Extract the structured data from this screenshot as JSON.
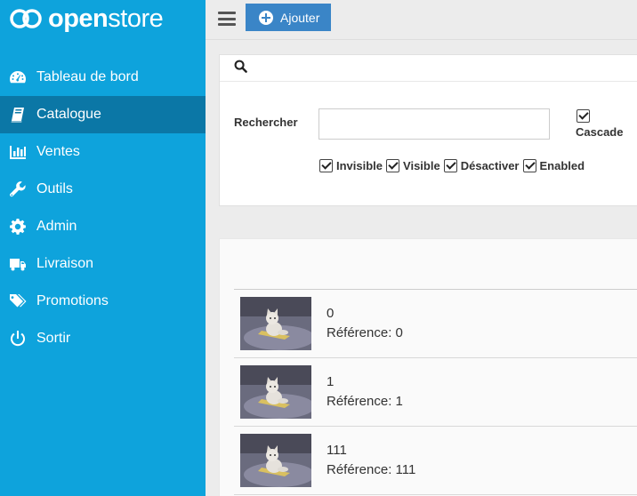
{
  "brand": {
    "name_bold": "open",
    "name_light": "store"
  },
  "sidebar": {
    "items": [
      {
        "label": "Tableau de bord",
        "icon": "dashboard-icon",
        "active": false
      },
      {
        "label": "Catalogue",
        "icon": "book-icon",
        "active": true
      },
      {
        "label": "Ventes",
        "icon": "bar-chart-icon",
        "active": false
      },
      {
        "label": "Outils",
        "icon": "wrench-icon",
        "active": false
      },
      {
        "label": "Admin",
        "icon": "gear-icon",
        "active": false
      },
      {
        "label": "Livraison",
        "icon": "truck-icon",
        "active": false
      },
      {
        "label": "Promotions",
        "icon": "tags-icon",
        "active": false
      },
      {
        "label": "Sortir",
        "icon": "power-icon",
        "active": false
      }
    ]
  },
  "toolbar": {
    "add_label": "Ajouter"
  },
  "search": {
    "label": "Rechercher",
    "value": "",
    "placeholder": "",
    "cascade_label": "Cascade",
    "cascade_checked": true,
    "filters": [
      {
        "label": "Invisible",
        "checked": true
      },
      {
        "label": "Visible",
        "checked": true
      },
      {
        "label": "Désactiver",
        "checked": true
      },
      {
        "label": "Enabled",
        "checked": true
      }
    ]
  },
  "results": {
    "rows": [
      {
        "name": "0",
        "reference": "Référence: 0"
      },
      {
        "name": "1",
        "reference": "Référence: 1"
      },
      {
        "name": "111",
        "reference": "Référence: 111"
      }
    ]
  },
  "colors": {
    "sidebar": "#0ea3dc",
    "sidebar_active": "#0b77a6",
    "primary_button": "#3a85c7"
  }
}
